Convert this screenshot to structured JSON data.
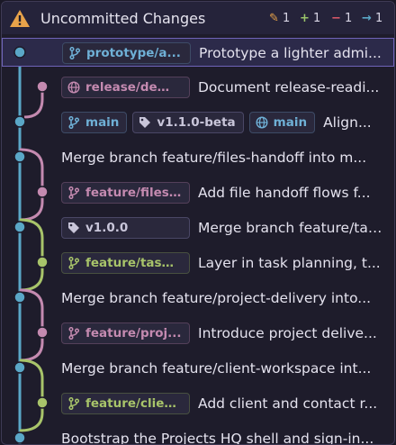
{
  "header": {
    "title": "Uncommitted Changes",
    "stats": {
      "modified": "1",
      "added": "1",
      "deleted": "1",
      "ahead": "1"
    }
  },
  "colors": {
    "main": "#5aa7c7",
    "release": "#c48ab0",
    "feature_files": "#c48ab0",
    "feature_task": "#a8c46a",
    "warning": "#e8a34a",
    "selection": "#6f63b8"
  },
  "commits": [
    {
      "refs": [
        {
          "type": "branch",
          "label": "prototype/a...",
          "color": "blue"
        }
      ],
      "message": "Prototype a lighter admi..."
    },
    {
      "refs": [
        {
          "type": "remote",
          "label": "release/dem...",
          "color": "pink"
        }
      ],
      "message": "Document release-readi..."
    },
    {
      "refs": [
        {
          "type": "branch",
          "label": "main",
          "color": "blue"
        },
        {
          "type": "tag",
          "label": "v1.1.0-beta",
          "color": "gray"
        },
        {
          "type": "remote",
          "label": "main",
          "color": "blue"
        }
      ],
      "message": "Align..."
    },
    {
      "refs": [],
      "message": "Merge branch feature/files-handoff into m..."
    },
    {
      "refs": [
        {
          "type": "branch",
          "label": "feature/files...",
          "color": "pink"
        }
      ],
      "message": "Add file handoff flows f..."
    },
    {
      "refs": [
        {
          "type": "tag",
          "label": "v1.0.0",
          "color": "gray"
        }
      ],
      "message": "Merge branch feature/task-wor..."
    },
    {
      "refs": [
        {
          "type": "branch",
          "label": "feature/task-...",
          "color": "green"
        }
      ],
      "message": "Layer in task planning, t..."
    },
    {
      "refs": [],
      "message": "Merge branch feature/project-delivery into..."
    },
    {
      "refs": [
        {
          "type": "branch",
          "label": "feature/proj...",
          "color": "pink"
        }
      ],
      "message": "Introduce project delive..."
    },
    {
      "refs": [],
      "message": "Merge branch feature/client-workspace int..."
    },
    {
      "refs": [
        {
          "type": "branch",
          "label": "feature/clien...",
          "color": "green"
        }
      ],
      "message": "Add client and contact r..."
    },
    {
      "refs": [],
      "message": "Bootstrap the Projects HQ shell and sign-in..."
    }
  ]
}
